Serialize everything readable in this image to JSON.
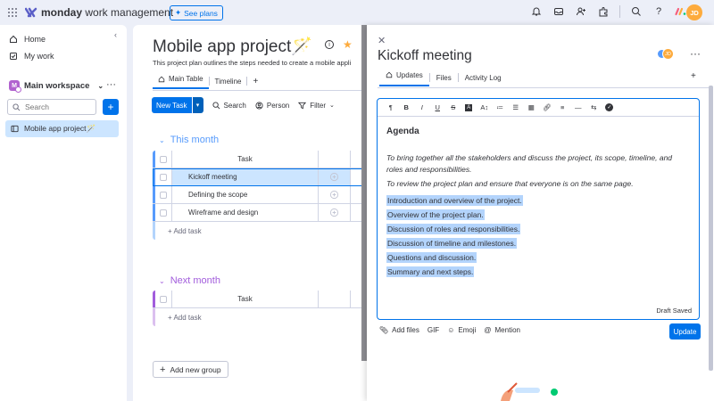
{
  "topbar": {
    "brand_bold": "monday",
    "brand_rest": " work management",
    "see_plans": "See plans",
    "avatar_initials": "JD"
  },
  "sidebar": {
    "home": "Home",
    "my_work": "My work",
    "workspace_badge": "M",
    "workspace": "Main workspace",
    "search_placeholder": "Search",
    "board_item": "Mobile app project🪄"
  },
  "board": {
    "title": "Mobile app project🪄",
    "description": "This project plan outlines the steps needed to create a mobile appli",
    "tabs": [
      "Main Table",
      "Timeline"
    ],
    "toolbar": {
      "new_task": "New Task",
      "search": "Search",
      "person": "Person",
      "filter": "Filter"
    },
    "groups": [
      {
        "title": "This month",
        "header": "Task",
        "rows": [
          "Kickoff meeting",
          "Defining the scope",
          "Wireframe and design"
        ],
        "add": "+ Add task"
      },
      {
        "title": "Next month",
        "header": "Task",
        "rows": [],
        "add": "+ Add task"
      }
    ],
    "add_group": "Add new group"
  },
  "panel": {
    "title": "Kickoff meeting",
    "tabs": [
      "Updates",
      "Files",
      "Activity Log"
    ],
    "editor": {
      "heading": "Agenda",
      "para1": "To bring together all the stakeholders and discuss the project, its scope, timeline, and roles and responsibilities.",
      "para2": "To review the project plan and ensure that everyone is on the same page.",
      "list": [
        "Introduction and overview of the project.",
        "Overview of the project plan.",
        "Discussion of roles and responsibilities.",
        "Discussion of timeline and milestones.",
        "Questions and discussion.",
        "Summary and next steps."
      ],
      "status": "Draft Saved"
    },
    "bottom": {
      "add_files": "Add files",
      "gif": "GIF",
      "emoji": "Emoji",
      "mention": "Mention",
      "update": "Update"
    }
  },
  "colors": {
    "accent": "#0073ea",
    "group_blue": "#579bfc",
    "group_purple": "#a25ddc",
    "highlight": "#b3d4fc"
  }
}
